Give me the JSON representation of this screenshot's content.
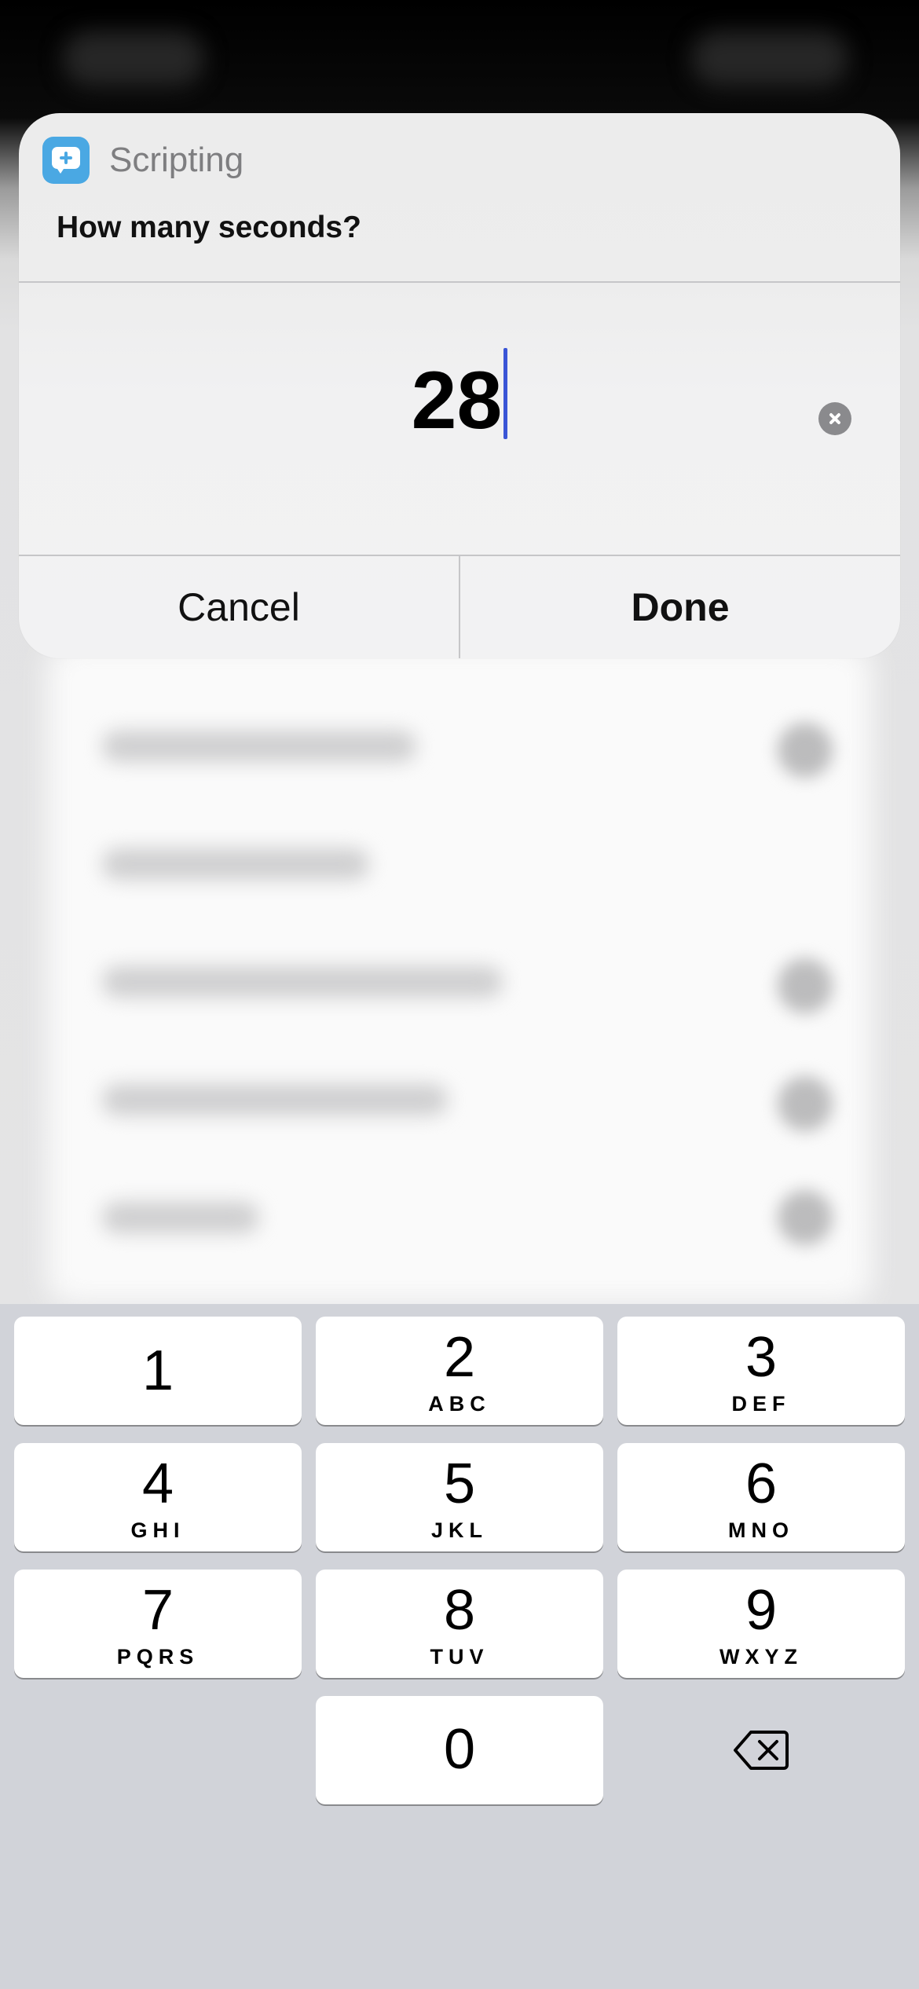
{
  "alert": {
    "app_name": "Scripting",
    "app_icon": "scripting-app-icon",
    "prompt": "How many seconds?",
    "input_value": "28",
    "clear_icon": "clear-circle-icon",
    "cancel_label": "Cancel",
    "done_label": "Done"
  },
  "keyboard": {
    "keys": [
      {
        "digit": "1",
        "letters": ""
      },
      {
        "digit": "2",
        "letters": "ABC"
      },
      {
        "digit": "3",
        "letters": "DEF"
      },
      {
        "digit": "4",
        "letters": "GHI"
      },
      {
        "digit": "5",
        "letters": "JKL"
      },
      {
        "digit": "6",
        "letters": "MNO"
      },
      {
        "digit": "7",
        "letters": "PQRS"
      },
      {
        "digit": "8",
        "letters": "TUV"
      },
      {
        "digit": "9",
        "letters": "WXYZ"
      },
      {
        "digit": "0",
        "letters": ""
      }
    ],
    "delete_icon": "backspace-icon"
  },
  "colors": {
    "app_icon_blue": "#4aa8e3",
    "caret_blue": "#3a55d6",
    "keyboard_bg": "#d1d3d9",
    "key_bg": "#ffffff"
  }
}
